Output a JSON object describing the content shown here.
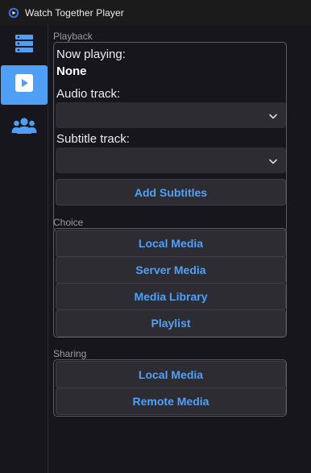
{
  "window": {
    "title": "Watch Together Player"
  },
  "sidebar": {
    "items": [
      {
        "icon": "server-list-icon",
        "active": false
      },
      {
        "icon": "play-icon",
        "active": true
      },
      {
        "icon": "users-icon",
        "active": false
      }
    ]
  },
  "playback": {
    "group_label": "Playback",
    "now_playing_label": "Now playing:",
    "now_playing_value": "None",
    "audio_label": "Audio track:",
    "audio_value": "",
    "subtitle_label": "Subtitle track:",
    "subtitle_value": "",
    "add_subtitles_label": "Add Subtitles"
  },
  "choice": {
    "group_label": "Choice",
    "buttons": [
      "Local Media",
      "Server Media",
      "Media Library",
      "Playlist"
    ]
  },
  "sharing": {
    "group_label": "Sharing",
    "buttons": [
      "Local Media",
      "Remote Media"
    ]
  },
  "colors": {
    "accent": "#4f9ff5",
    "button_text": "#4fa0f7",
    "background": "#17161c",
    "control": "#2d2c33"
  }
}
